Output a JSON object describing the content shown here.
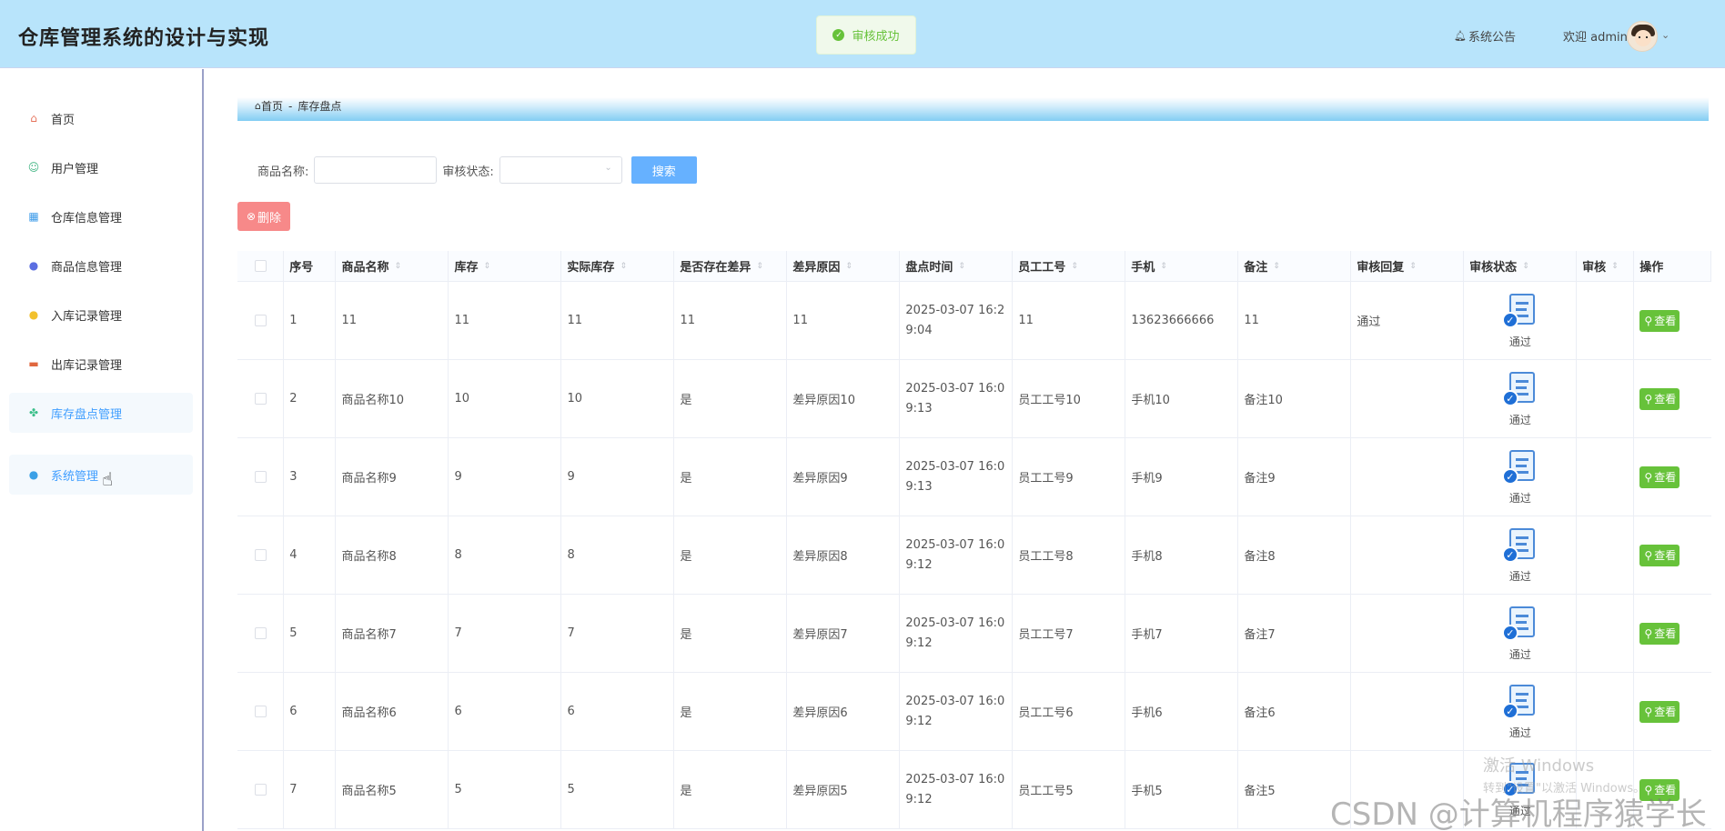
{
  "header": {
    "title": "仓库管理系统的设计与实现",
    "toast": "审核成功",
    "notice": "系统公告",
    "welcome": "欢迎 admin"
  },
  "sidebar": {
    "items": [
      {
        "label": "首页",
        "icon": "home-icon",
        "color": "#e6735c"
      },
      {
        "label": "用户管理",
        "icon": "user-icon",
        "color": "#43b584"
      },
      {
        "label": "仓库信息管理",
        "icon": "grid-icon",
        "color": "#3d9be9"
      },
      {
        "label": "商品信息管理",
        "icon": "goods-icon",
        "color": "#5b6ee1"
      },
      {
        "label": "入库记录管理",
        "icon": "inbound-icon",
        "color": "#f2c12e"
      },
      {
        "label": "出库记录管理",
        "icon": "outbound-icon",
        "color": "#e0673f"
      },
      {
        "label": "库存盘点管理",
        "icon": "inventory-icon",
        "color": "#3bbf8a"
      },
      {
        "label": "系统管理",
        "icon": "system-icon",
        "color": "#3ba0e6"
      }
    ]
  },
  "breadcrumb": {
    "home": "首页",
    "sep": "-",
    "current": "库存盘点"
  },
  "search": {
    "name_label": "商品名称:",
    "status_label": "审核状态:",
    "button": "搜索"
  },
  "delete_label": "删除",
  "table": {
    "headers": [
      "序号",
      "商品名称",
      "库存",
      "实际库存",
      "是否存在差异",
      "差异原因",
      "盘点时间",
      "员工工号",
      "手机",
      "备注",
      "审核回复",
      "审核状态",
      "审核",
      "操作"
    ],
    "status_text": "通过",
    "view_label": "查看",
    "rows": [
      {
        "no": "1",
        "name": "11",
        "stock": "11",
        "actual": "11",
        "diff": "11",
        "reason": "11",
        "time": "2025-03-07 16:29:04",
        "emp": "11",
        "phone": "13623666666",
        "remark": "11",
        "reply": "通过"
      },
      {
        "no": "2",
        "name": "商品名称10",
        "stock": "10",
        "actual": "10",
        "diff": "是",
        "reason": "差异原因10",
        "time": "2025-03-07 16:09:13",
        "emp": "员工工号10",
        "phone": "手机10",
        "remark": "备注10",
        "reply": ""
      },
      {
        "no": "3",
        "name": "商品名称9",
        "stock": "9",
        "actual": "9",
        "diff": "是",
        "reason": "差异原因9",
        "time": "2025-03-07 16:09:13",
        "emp": "员工工号9",
        "phone": "手机9",
        "remark": "备注9",
        "reply": ""
      },
      {
        "no": "4",
        "name": "商品名称8",
        "stock": "8",
        "actual": "8",
        "diff": "是",
        "reason": "差异原因8",
        "time": "2025-03-07 16:09:12",
        "emp": "员工工号8",
        "phone": "手机8",
        "remark": "备注8",
        "reply": ""
      },
      {
        "no": "5",
        "name": "商品名称7",
        "stock": "7",
        "actual": "7",
        "diff": "是",
        "reason": "差异原因7",
        "time": "2025-03-07 16:09:12",
        "emp": "员工工号7",
        "phone": "手机7",
        "remark": "备注7",
        "reply": ""
      },
      {
        "no": "6",
        "name": "商品名称6",
        "stock": "6",
        "actual": "6",
        "diff": "是",
        "reason": "差异原因6",
        "time": "2025-03-07 16:09:12",
        "emp": "员工工号6",
        "phone": "手机6",
        "remark": "备注6",
        "reply": ""
      },
      {
        "no": "7",
        "name": "商品名称5",
        "stock": "5",
        "actual": "5",
        "diff": "是",
        "reason": "差异原因5",
        "time": "2025-03-07 16:09:12",
        "emp": "员工工号5",
        "phone": "手机5",
        "remark": "备注5",
        "reply": ""
      }
    ]
  },
  "watermark": {
    "win1": "激活 Windows",
    "win2": "转到\"设置\"以激活 Windows。",
    "csdn": "CSDN @计算机程序猿学长"
  }
}
